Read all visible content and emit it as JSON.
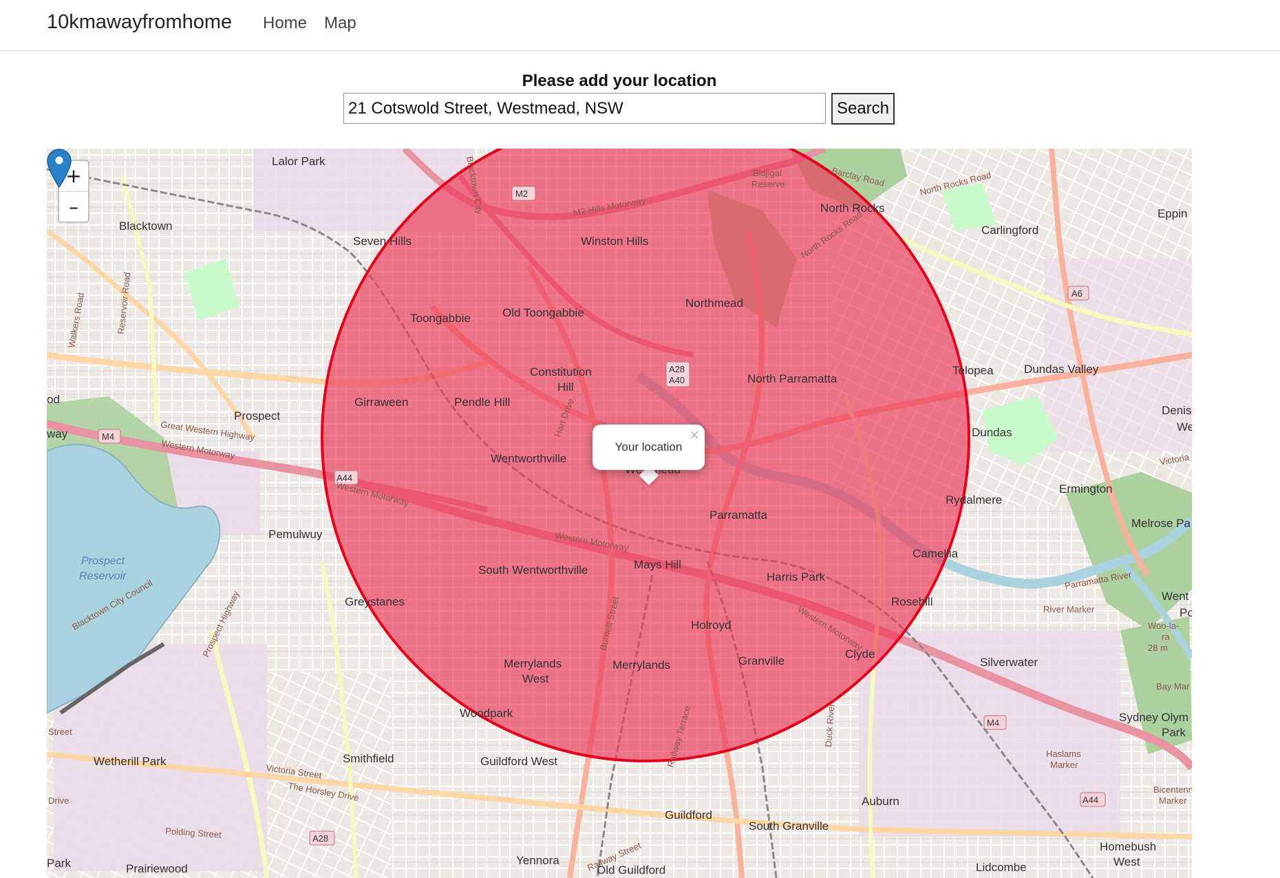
{
  "navbar": {
    "brand": "10kmawayfromhome",
    "links": [
      {
        "label": "Home"
      },
      {
        "label": "Map"
      }
    ]
  },
  "form": {
    "heading": "Please add your location",
    "location_value": "21 Cotswold Street, Westmead, NSW",
    "search_label": "Search"
  },
  "map": {
    "zoom_in": "+",
    "zoom_out": "–",
    "radius_circle_color": "#e8001c",
    "radius_fill_color": "#ec3b5a",
    "marker_color": "#2a81cb",
    "popup_text": "Your location",
    "popup_close": "×",
    "place_labels": [
      "Lalor Park",
      "Blacktown",
      "Seven Hills",
      "Winston Hills",
      "North Rocks",
      "Carlingford",
      "Eppin",
      "Toongabbie",
      "Old Toongabbie",
      "Northmead",
      "Constitution",
      "Hill",
      "North Parramatta",
      "Telopea",
      "Dundas Valley",
      "Girraween",
      "Pendle Hill",
      "Prospect",
      "Dundas",
      "Denis",
      "We",
      "Wentworthville",
      "Westmead",
      "Rydalmere",
      "Ermington",
      "Parramatta",
      "Melrose Pa",
      "Pemulwuy",
      "Mays Hill",
      "Camellia",
      "South Wentworthville",
      "Harris Park",
      "Rosehill",
      "Greystanes",
      "Holroyd",
      "Went",
      "Po",
      "Clyde",
      "Silverwater",
      "Merrylands",
      "West",
      "Merrylands",
      "Granville",
      "Woodpark",
      "Sydney Olym",
      "Park",
      "Wetherill Park",
      "Smithfield",
      "Guildford West",
      "Auburn",
      "Guildford",
      "South Granville",
      "Homebush",
      "West",
      "Yennora",
      "Old Guildford",
      "Lidcombe",
      "Prairiewood",
      "Park",
      "od",
      "way"
    ],
    "water_labels": [
      "Prospect",
      "Reservoir"
    ],
    "road_labels": [
      "M2 Hills Motorway",
      "Great Western Highway",
      "Western Motorway",
      "North Rocks Road",
      "Barclay Road",
      "North Rocks Road",
      "Walkers Road",
      "Reservoir Road",
      "Blacktown City Council",
      "Prospect Highway",
      "Hart Drive",
      "Burnett Street",
      "Railway Terrace",
      "Duck River",
      "Victoria Street",
      "The Horsley Drive",
      "Polding Street",
      "Parramatta River",
      "River Marker",
      "Bay Mar",
      "Haslams",
      "Marker",
      "Bicentenn",
      "Marker",
      "Woo-la-",
      "ra",
      "28 m",
      "Bidjigal",
      "Reserve",
      "Street",
      "Drive",
      "Railway Street",
      "Victoria R",
      "Blacktown City"
    ],
    "shields": [
      "M2",
      "A28",
      "A40",
      "M4",
      "A44",
      "A6",
      "M4",
      "A44",
      "A28"
    ]
  }
}
